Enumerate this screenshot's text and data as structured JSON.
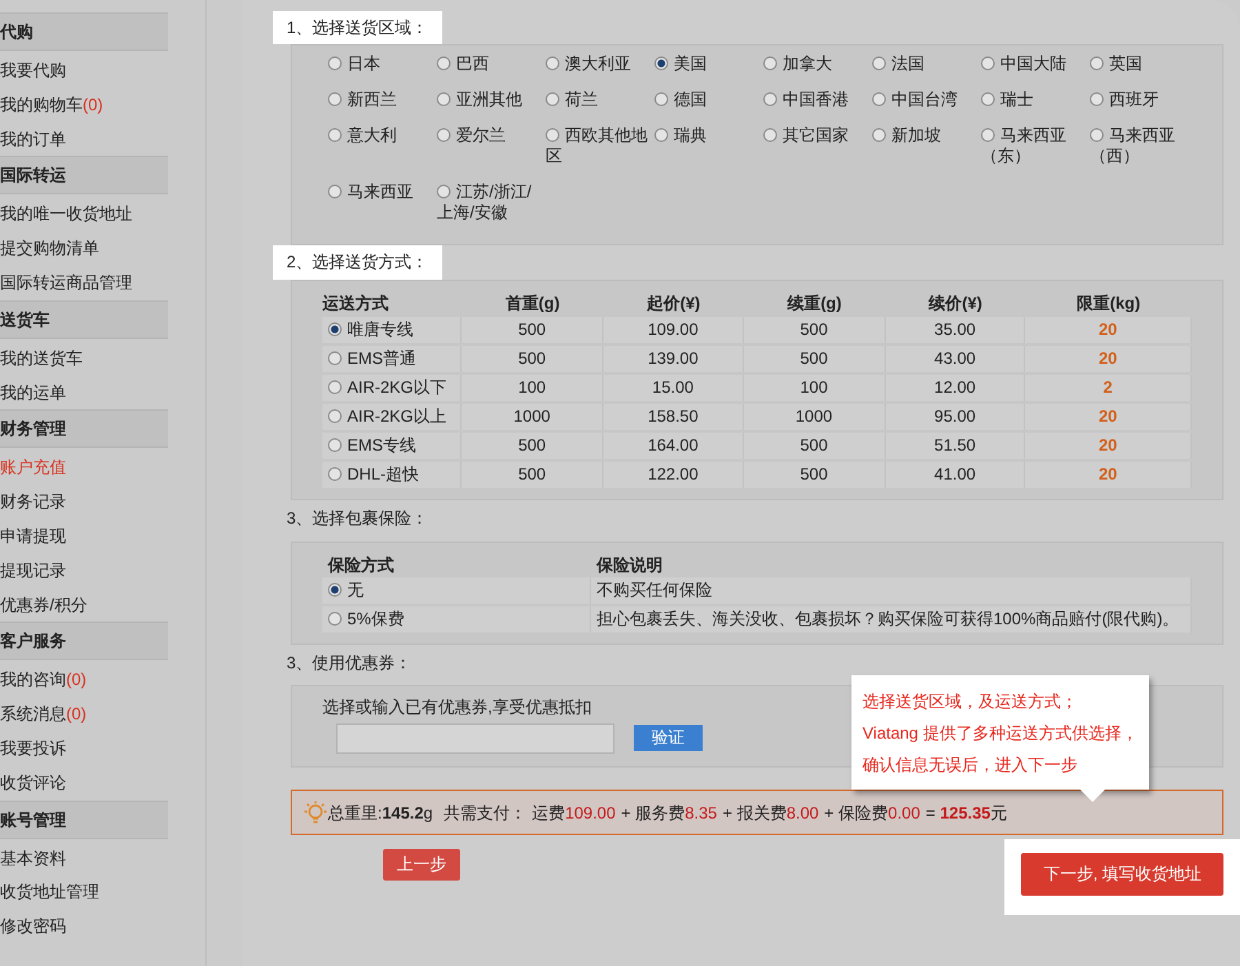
{
  "sidebar": {
    "sections": [
      {
        "title": "代购",
        "items": [
          {
            "label": "我要代购",
            "selected": false
          },
          {
            "label": "我的购物车",
            "count": "(0)",
            "selected": false
          },
          {
            "label": "我的订单",
            "selected": false
          }
        ]
      },
      {
        "title": "国际转运",
        "items": [
          {
            "label": "我的唯一收货地址",
            "selected": false
          },
          {
            "label": "提交购物清单",
            "selected": false
          },
          {
            "label": "国际转运商品管理",
            "selected": false
          }
        ]
      },
      {
        "title": "送货车",
        "items": [
          {
            "label": "我的送货车",
            "selected": false
          },
          {
            "label": "我的运单",
            "selected": false
          }
        ]
      },
      {
        "title": "财务管理",
        "items": [
          {
            "label": "账户充值",
            "selected": true
          },
          {
            "label": "财务记录",
            "selected": false
          },
          {
            "label": "申请提现",
            "selected": false
          },
          {
            "label": "提现记录",
            "selected": false
          },
          {
            "label": "优惠券/积分",
            "selected": false
          }
        ]
      },
      {
        "title": "客户服务",
        "items": [
          {
            "label": "我的咨询",
            "count": "(0)",
            "selected": false
          },
          {
            "label": "系统消息",
            "count": "(0)",
            "selected": false
          },
          {
            "label": "我要投诉",
            "selected": false
          },
          {
            "label": "收货评论",
            "selected": false
          }
        ]
      },
      {
        "title": "账号管理",
        "items": [
          {
            "label": "基本资料",
            "selected": false
          },
          {
            "label": "收货地址管理",
            "selected": false
          },
          {
            "label": "修改密码",
            "selected": false
          }
        ]
      }
    ]
  },
  "region": {
    "heading": "1、选择送货区域：",
    "options": [
      {
        "label": "日本",
        "selected": false
      },
      {
        "label": "巴西",
        "selected": false
      },
      {
        "label": "澳大利亚",
        "selected": false
      },
      {
        "label": "美国",
        "selected": true
      },
      {
        "label": "加拿大",
        "selected": false
      },
      {
        "label": "法国",
        "selected": false
      },
      {
        "label": "中国大陆",
        "selected": false
      },
      {
        "label": "英国",
        "selected": false
      },
      {
        "label": "新西兰",
        "selected": false
      },
      {
        "label": "亚洲其他",
        "selected": false
      },
      {
        "label": "荷兰",
        "selected": false
      },
      {
        "label": "德国",
        "selected": false
      },
      {
        "label": "中国香港",
        "selected": false
      },
      {
        "label": "中国台湾",
        "selected": false
      },
      {
        "label": "瑞士",
        "selected": false
      },
      {
        "label": "西班牙",
        "selected": false
      },
      {
        "label": "意大利",
        "selected": false
      },
      {
        "label": "爱尔兰",
        "selected": false
      },
      {
        "label": "西欧其他地区",
        "selected": false
      },
      {
        "label": "瑞典",
        "selected": false
      },
      {
        "label": "其它国家",
        "selected": false
      },
      {
        "label": "新加坡",
        "selected": false
      },
      {
        "label": "马来西亚（东）",
        "selected": false
      },
      {
        "label": "马来西亚（西）",
        "selected": false
      },
      {
        "label": "马来西亚",
        "selected": false
      },
      {
        "label": "江苏/浙江/上海/安徽",
        "selected": false
      }
    ]
  },
  "shipping": {
    "heading": "2、选择送货方式：",
    "columns": [
      "运送方式",
      "首重(g)",
      "起价(¥)",
      "续重(g)",
      "续价(¥)",
      "限重(kg)"
    ],
    "rows": [
      {
        "method": "唯唐专线",
        "first_weight": "500",
        "start_price": "109.00",
        "extra_weight": "500",
        "extra_price": "35.00",
        "limit": "20",
        "selected": true
      },
      {
        "method": "EMS普通",
        "first_weight": "500",
        "start_price": "139.00",
        "extra_weight": "500",
        "extra_price": "43.00",
        "limit": "20",
        "selected": false
      },
      {
        "method": "AIR-2KG以下",
        "first_weight": "100",
        "start_price": "15.00",
        "extra_weight": "100",
        "extra_price": "12.00",
        "limit": "2",
        "selected": false
      },
      {
        "method": "AIR-2KG以上",
        "first_weight": "1000",
        "start_price": "158.50",
        "extra_weight": "1000",
        "extra_price": "95.00",
        "limit": "20",
        "selected": false
      },
      {
        "method": "EMS专线",
        "first_weight": "500",
        "start_price": "164.00",
        "extra_weight": "500",
        "extra_price": "51.50",
        "limit": "20",
        "selected": false
      },
      {
        "method": "DHL-超快",
        "first_weight": "500",
        "start_price": "122.00",
        "extra_weight": "500",
        "extra_price": "41.00",
        "limit": "20",
        "selected": false
      }
    ]
  },
  "insurance": {
    "heading": "3、选择包裹保险：",
    "columns": [
      "保险方式",
      "保险说明"
    ],
    "rows": [
      {
        "option": "无",
        "description": "不购买任何保险",
        "selected": true
      },
      {
        "option": "5%保费",
        "description": "担心包裹丢失、海关没收、包裹损坏？购买保险可获得100%商品赔付(限代购)。",
        "selected": false
      }
    ]
  },
  "coupon": {
    "heading": "3、使用优惠券：",
    "label": "选择或输入已有优惠券,享受优惠抵扣",
    "button": "验证"
  },
  "summary": {
    "weight_label": "总重里:",
    "weight": "145.2",
    "weight_unit": "g",
    "pay_label": "共需支付：",
    "fees": [
      {
        "label": "运费",
        "value": "109.00"
      },
      {
        "label": "+ 服务费",
        "value": "8.35"
      },
      {
        "label": "+ 报关费",
        "value": "8.00"
      },
      {
        "label": "+ 保险费",
        "value": "0.00"
      }
    ],
    "total_prefix": "=",
    "total": "125.35",
    "total_unit": "元"
  },
  "tooltip": {
    "lines": [
      "选择送货区域，及运送方式；",
      "Viatang 提供了多种运送方式供选择，",
      "确认信息无误后，进入下一步"
    ]
  },
  "buttons": {
    "back": "上一步",
    "next": "下一步, 填写收货地址"
  }
}
